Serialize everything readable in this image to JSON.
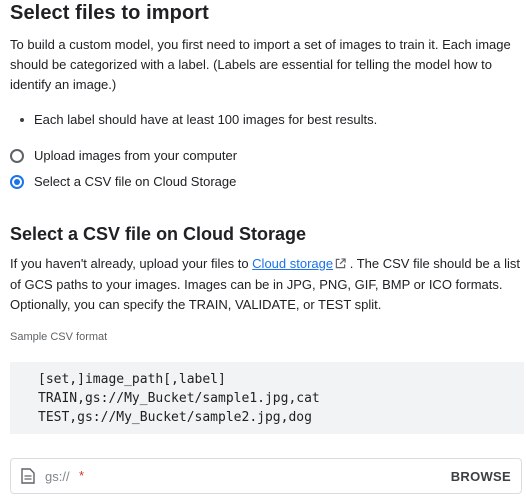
{
  "import": {
    "title": "Select files to import",
    "intro": "To build a custom model, you first need to import a set of images to train it. Each image should be categorized with a label. (Labels are essential for telling the model how to identify an image.)",
    "bullet": "Each label should have at least 100 images for best results.",
    "options": [
      {
        "label": "Upload images from your computer",
        "selected": false
      },
      {
        "label": "Select a CSV file on Cloud Storage",
        "selected": true
      }
    ]
  },
  "csv": {
    "title": "Select a CSV file on Cloud Storage",
    "desc_before_link": "If you haven't already, upload your files to ",
    "link_text": "Cloud storage",
    "desc_after_link": " . The CSV file should be a list of GCS paths to your images. Images can be in JPG, PNG, GIF, BMP or ICO formats. Optionally, you can specify the TRAIN, VALIDATE, or TEST split.",
    "sample_label": "Sample CSV format",
    "sample_lines": [
      "[set,]image_path[,label]",
      "TRAIN,gs://My_Bucket/sample1.jpg,cat",
      "TEST,gs://My_Bucket/sample2.jpg,dog"
    ],
    "field": {
      "placeholder": "gs://",
      "required_mark": "*",
      "browse_label": "BROWSE"
    }
  },
  "colors": {
    "accent": "#1a73e8",
    "required": "#d93025",
    "code_bg": "#f1f3f4"
  },
  "icons": {
    "link": "external-link-icon",
    "field": "file-document-icon"
  }
}
